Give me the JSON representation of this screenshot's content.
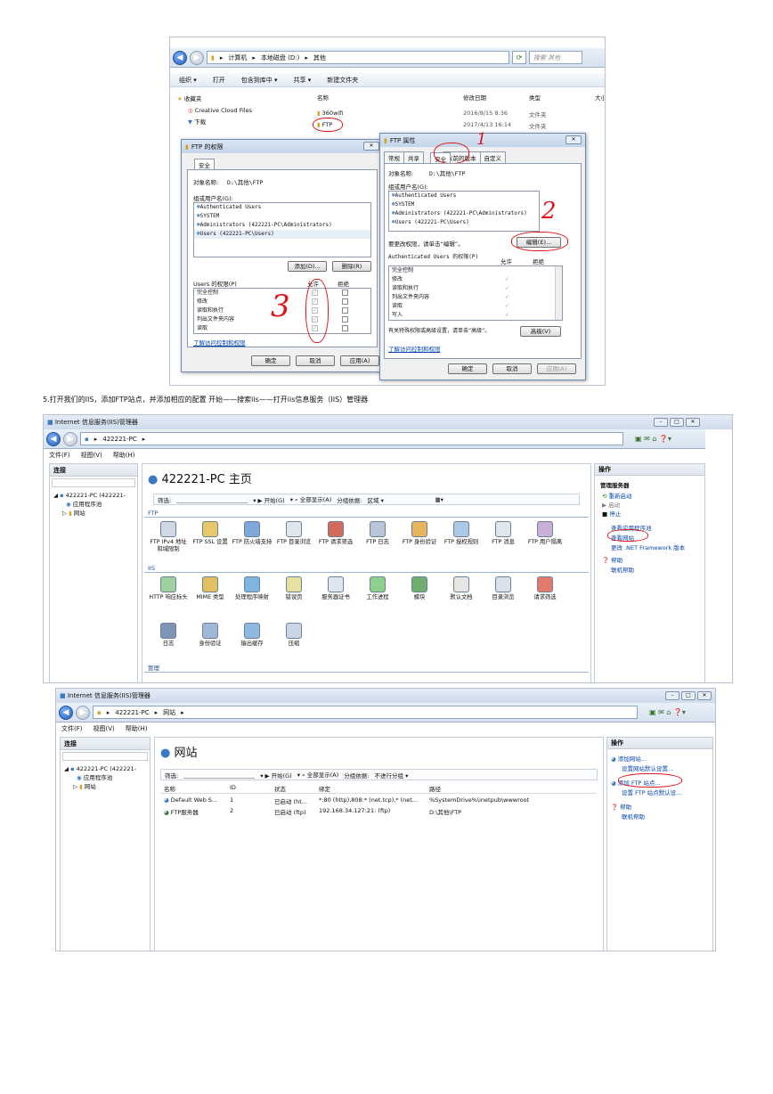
{
  "step5_text": "5.打开我们的IIS，添加FTP站点，并添加相应的配置 开始——搜索iis——打开iis信息服务（IIS）管理器",
  "colors": {
    "annotation_red": "#e0141b",
    "link_blue": "#0645ad",
    "panel_header": "#dfe6ee"
  },
  "explorer": {
    "breadcrumb": [
      "计算机",
      "本地磁盘 (D:)",
      "其他"
    ],
    "search_placeholder": "搜索 其他",
    "commands": [
      "组织 ▾",
      "打开",
      "包含到库中 ▾",
      "共享 ▾",
      "新建文件夹"
    ],
    "sidebar": [
      "收藏夹",
      "Creative Cloud Files",
      "下载"
    ],
    "columns": [
      "名称",
      "修改日期",
      "类型",
      "大小"
    ],
    "files": [
      {
        "name": "360wifi",
        "date": "2016/8/15 8:36",
        "type": "文件夹"
      },
      {
        "name": "FTP",
        "date": "2017/4/13 16:14",
        "type": "文件夹"
      }
    ],
    "perm_dialog": {
      "title": "FTP 的权限",
      "tab": "安全",
      "object_label": "对象名称:",
      "object_value": "D:\\其他\\FTP",
      "group_label": "组或用户名(G):",
      "users": [
        "Authenticated Users",
        "SYSTEM",
        "Administrators (422221-PC\\Administrators)",
        "Users (422221-PC\\Users)"
      ],
      "add_btn": "添加(D)...",
      "remove_btn": "删除(R)",
      "perms_label": "Users 的权限(P)",
      "allow": "允许",
      "deny": "拒绝",
      "perms": [
        "完全控制",
        "修改",
        "读取和执行",
        "列出文件夹内容",
        "读取"
      ],
      "learn_link": "了解访问控制和权限",
      "ok": "确定",
      "cancel": "取消",
      "apply": "应用(A)",
      "mark": "3"
    },
    "prop_dialog": {
      "title": "FTP 属性",
      "tabs": [
        "常规",
        "共享",
        "安全",
        "以前的版本",
        "自定义"
      ],
      "object_label": "对象名称:",
      "object_value": "D:\\其他\\FTP",
      "group_label": "组或用户名(G):",
      "users": [
        "Authenticated Users",
        "SYSTEM",
        "Administrators (422221-PC\\Administrators)",
        "Users (422221-PC\\Users)"
      ],
      "edit_hint": "要更改权限，请单击“编辑”。",
      "edit_btn": "编辑(E)...",
      "perms_label": "Authenticated Users 的权限(P)",
      "allow": "允许",
      "deny": "拒绝",
      "perms": [
        "完全控制",
        "修改",
        "读取和执行",
        "列出文件夹内容",
        "读取",
        "写入"
      ],
      "adv_hint": "有关特殊权限或高级设置，请单击“高级”。",
      "adv_btn": "高级(V)",
      "learn_link": "了解访问控制和权限",
      "ok": "确定",
      "cancel": "取消",
      "apply": "应用(A)",
      "mark1": "1",
      "mark2": "2"
    }
  },
  "iis1": {
    "title": "Internet 信息服务(IIS)管理器",
    "breadcrumb": [
      "422221-PC"
    ],
    "menu": [
      "文件(F)",
      "视图(V)",
      "帮助(H)"
    ],
    "conn_header": "连接",
    "tree": [
      "422221-PC (422221-",
      "应用程序池",
      "网站"
    ],
    "page_title": "422221-PC 主页",
    "filter_label": "筛选:",
    "start_label": "开始(G)",
    "showall_label": "全部显示(A)",
    "groupby_label": "分组依据:",
    "groupby_value": "区域",
    "group_ftp": "FTP",
    "group_iis": "IIS",
    "group_manage": "管理",
    "ftp_icons": [
      "FTP IPv4 地址和域限制",
      "FTP SSL 设置",
      "FTP 防火墙支持",
      "FTP 目录浏览",
      "FTP 请求筛选",
      "FTP 日志",
      "FTP 身份验证",
      "FTP 授权规则",
      "FTP 消息",
      "FTP 用户隔离"
    ],
    "iis_icons_row1": [
      "HTTP 响应标头",
      "MIME 类型",
      "处理程序映射",
      "错误页",
      "服务器证书",
      "工作进程",
      "模块",
      "默认文档",
      "目录浏览",
      "请求筛选"
    ],
    "iis_icons_row2": [
      "日志",
      "身份验证",
      "输出缓存",
      "压缩"
    ],
    "actions_header": "操作",
    "actions_section": "管理服务器",
    "actions": [
      "重新启动",
      "启动",
      "停止",
      "查看应用程序池",
      "查看网站",
      "更改 .NET Framework 版本",
      "帮助",
      "联机帮助"
    ]
  },
  "iis2": {
    "title": "Internet 信息服务(IIS)管理器",
    "breadcrumb": [
      "422221-PC",
      "网站"
    ],
    "menu": [
      "文件(F)",
      "视图(V)",
      "帮助(H)"
    ],
    "conn_header": "连接",
    "tree": [
      "422221-PC (422221-",
      "应用程序池",
      "网站"
    ],
    "page_title": "网站",
    "filter_label": "筛选:",
    "start_label": "开始(G)",
    "showall_label": "全部显示(A)",
    "groupby_label": "分组依据:",
    "groupby_value": "不进行分组",
    "columns": [
      "名称",
      "ID",
      "状态",
      "绑定",
      "路径"
    ],
    "sites": [
      {
        "name": "Default Web S...",
        "id": "1",
        "status": "已启动 (ht...",
        "binding": "*:80 (http),808:* (net.tcp),* (net...",
        "path": "%SystemDrive%\\inetpub\\wwwroot"
      },
      {
        "name": "FTP服务器",
        "id": "2",
        "status": "已启动 (ftp)",
        "binding": "192.168.34.127:21: (ftp)",
        "path": "D:\\其他\\FTP"
      }
    ],
    "actions_header": "操作",
    "actions": [
      "添加网站...",
      "设置网站默认设置...",
      "添加 FTP 站点...",
      "设置 FTP 站点默认设...",
      "帮助",
      "联机帮助"
    ]
  }
}
